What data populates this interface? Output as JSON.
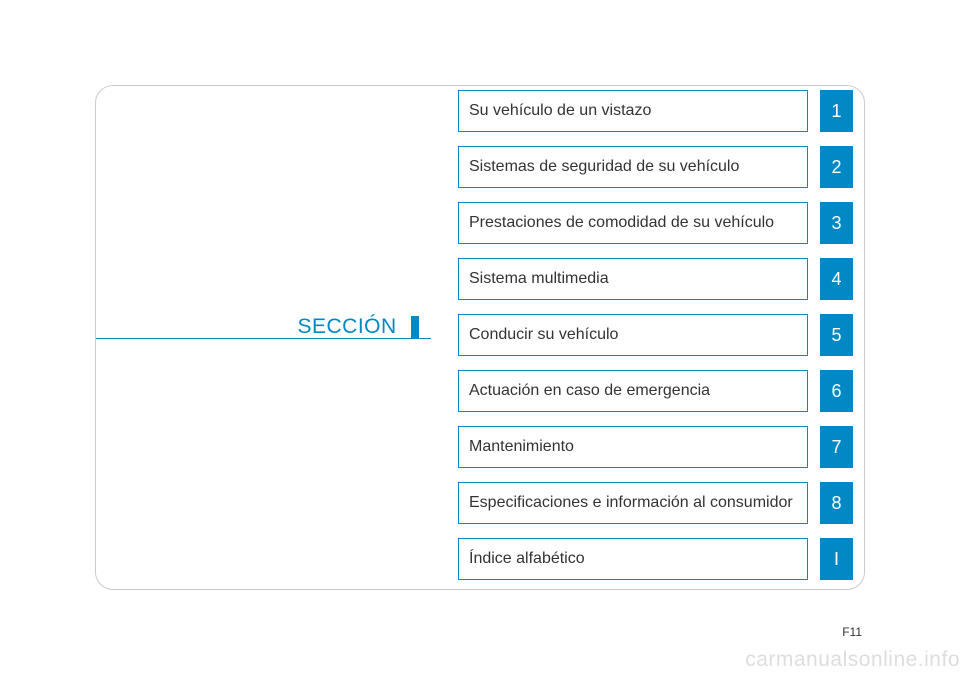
{
  "section_heading": "SECCIÓN",
  "toc": [
    {
      "label": "Su vehículo de un vistazo",
      "num": "1"
    },
    {
      "label": "Sistemas de seguridad de su vehículo",
      "num": "2"
    },
    {
      "label": "Prestaciones de comodidad de su vehículo",
      "num": "3"
    },
    {
      "label": "Sistema multimedia",
      "num": "4"
    },
    {
      "label": "Conducir su vehículo",
      "num": "5"
    },
    {
      "label": "Actuación en caso de emergencia",
      "num": "6"
    },
    {
      "label": "Mantenimiento",
      "num": "7"
    },
    {
      "label": "Especificaciones e información al consumidor",
      "num": "8"
    },
    {
      "label": "Índice alfabético",
      "num": "I"
    }
  ],
  "page_number": "F11",
  "watermark": "carmanualsonline.info"
}
